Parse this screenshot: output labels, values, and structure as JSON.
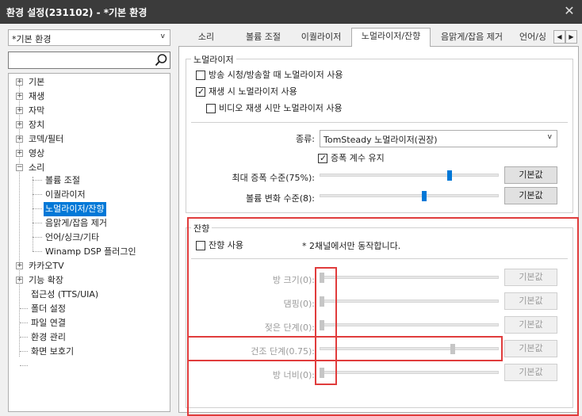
{
  "window": {
    "title": "환경 설정(231102) - *기본 환경",
    "close_glyph": "✕"
  },
  "preset": {
    "value": "*기본 환경",
    "arrow": "v"
  },
  "search": {
    "placeholder": "",
    "value": ""
  },
  "tree": {
    "items": [
      {
        "label": "기본",
        "expandable": true
      },
      {
        "label": "재생",
        "expandable": true
      },
      {
        "label": "자막",
        "expandable": true
      },
      {
        "label": "장치",
        "expandable": true
      },
      {
        "label": "코덱/필터",
        "expandable": true
      },
      {
        "label": "영상",
        "expandable": true
      },
      {
        "label": "소리",
        "expandable": true,
        "expanded": true
      },
      {
        "label": "볼륨 조절"
      },
      {
        "label": "이퀄라이저"
      },
      {
        "label": "노멀라이저/잔향",
        "selected": true
      },
      {
        "label": "음맑게/잡음 제거"
      },
      {
        "label": "언어/싱크/기타"
      },
      {
        "label": "Winamp DSP 플러그인"
      },
      {
        "label": "카카오TV",
        "expandable": true
      },
      {
        "label": "기능 확장",
        "expandable": true
      },
      {
        "label": "접근성 (TTS/UIA)"
      },
      {
        "label": "폴더 설정"
      },
      {
        "label": "파일 연결"
      },
      {
        "label": "환경 관리"
      },
      {
        "label": "화면 보호기"
      }
    ]
  },
  "tabs": [
    {
      "label": "소리"
    },
    {
      "label": "볼륨 조절"
    },
    {
      "label": "이퀄라이저"
    },
    {
      "label": "노멀라이저/잔향",
      "active": true
    },
    {
      "label": "음맑게/잡음 제거"
    },
    {
      "label": "언어/싱"
    }
  ],
  "tab_arrows": {
    "left": "◀",
    "right": "▶"
  },
  "normalizer": {
    "title": "노멀라이저",
    "check_broadcast": {
      "label": "방송 시청/방송할 때 노멀라이저 사용",
      "checked": false
    },
    "check_playback": {
      "label": "재생 시 노멀라이저 사용",
      "checked": true
    },
    "check_video_only": {
      "label": "비디오 재생 시만 노멀라이저 사용",
      "checked": false
    },
    "type_label": "종류:",
    "type_value": "TomSteady 노멀라이저(권장)",
    "type_arrow": "v",
    "keep_gain": {
      "label": "증폭 계수 유지",
      "checked": true
    },
    "max_gain": {
      "label": "최대 증폭 수준(75%):",
      "value": 0.75,
      "button": "기본값"
    },
    "volume_change": {
      "label": "볼륨 변화 수준(8):",
      "value": 0.57,
      "button": "기본값"
    }
  },
  "reverb": {
    "title": "잔향",
    "use": {
      "label": "잔향 사용",
      "checked": false
    },
    "note": "* 2채널에서만 동작합니다.",
    "sliders": [
      {
        "label": "방 크기(0):",
        "value": 0.0,
        "button": "기본값"
      },
      {
        "label": "댐핑(0):",
        "value": 0.0,
        "button": "기본값"
      },
      {
        "label": "젖은 단계(0):",
        "value": 0.0,
        "button": "기본값"
      },
      {
        "label": "건조 단계(0.75):",
        "value": 0.75,
        "button": "기본값"
      },
      {
        "label": "방 너비(0):",
        "value": 0.0,
        "button": "기본값"
      }
    ]
  },
  "colors": {
    "accent": "#0078d7",
    "highlight": "#e03c3c",
    "disabled_text": "#9b9b9b",
    "titlebar": "#3b3b3b"
  }
}
